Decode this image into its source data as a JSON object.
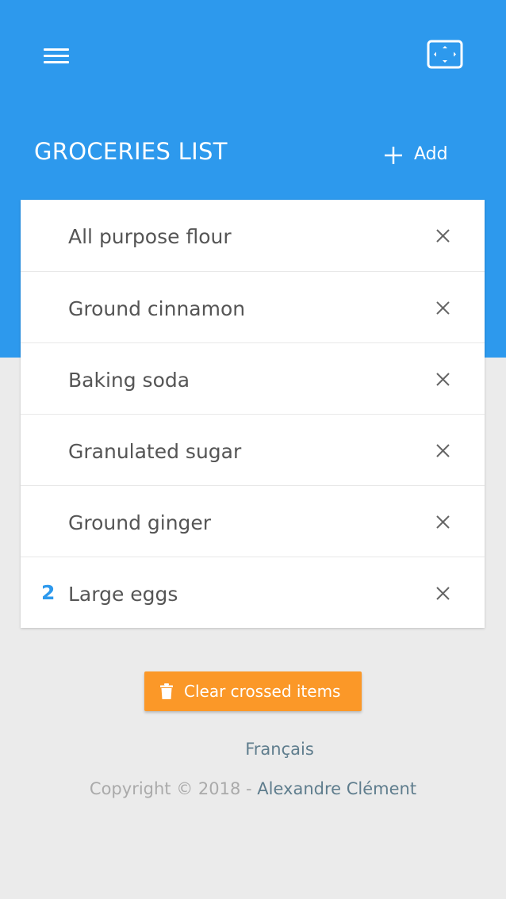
{
  "header": {
    "title": "GROCERIES LIST",
    "add_label": "Add",
    "menu_icon": "hamburger-menu-icon",
    "fullscreen_icon": "fullscreen-icon"
  },
  "items": [
    {
      "qty": "",
      "name": "All purpose flour"
    },
    {
      "qty": "",
      "name": "Ground cinnamon"
    },
    {
      "qty": "",
      "name": "Baking soda"
    },
    {
      "qty": "",
      "name": "Granulated sugar"
    },
    {
      "qty": "",
      "name": "Ground ginger"
    },
    {
      "qty": "2",
      "name": "Large eggs"
    }
  ],
  "actions": {
    "clear_label": "Clear crossed items"
  },
  "footer": {
    "language": "Français",
    "copyright": "Copyright © 2018 - ",
    "author": "Alexandre Clément"
  },
  "colors": {
    "primary": "#2d99ed",
    "accent": "#fb9828",
    "background": "#ebebeb",
    "link": "#5f7d8d"
  }
}
